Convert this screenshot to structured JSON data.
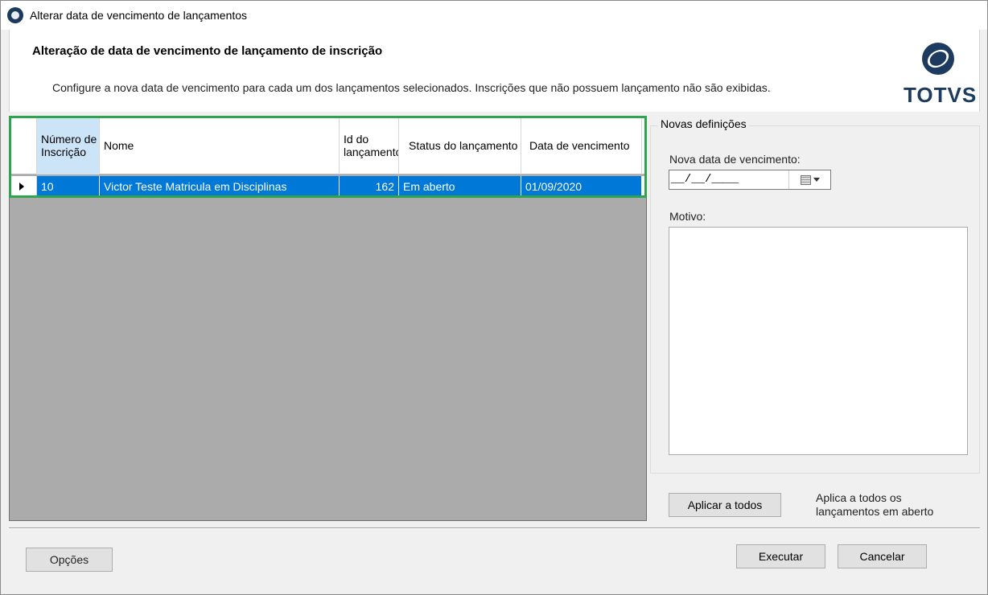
{
  "window": {
    "title": "Alterar data de vencimento de lançamentos",
    "icon": "app-icon"
  },
  "header": {
    "title": "Alteração de data de vencimento de lançamento de inscrição",
    "description": "Configure a nova data de vencimento para cada um dos lançamentos selecionados. Inscrições que não possuem lançamento não são exibidas.",
    "logo_text": "TOTVS"
  },
  "grid": {
    "columns": [
      {
        "label": "Número de Inscrição",
        "selected": true
      },
      {
        "label": "Nome",
        "selected": false
      },
      {
        "label": "Id do lançamento",
        "selected": false
      },
      {
        "label": "Status do lançamento",
        "selected": false
      },
      {
        "label": "Data de vencimento",
        "selected": false
      }
    ],
    "rows": [
      {
        "numero": "10",
        "nome": "Victor Teste Matricula em Disciplinas",
        "id": "162",
        "status": "Em aberto",
        "data": "01/09/2020",
        "selected": true
      }
    ]
  },
  "panel": {
    "legend": "Novas definições",
    "date_label": "Nova data de vencimento:",
    "date_value": "__/__/____",
    "reason_label": "Motivo:",
    "reason_value": "",
    "apply_all_label": "Aplicar a todos",
    "apply_hint": "Aplica a todos os lançamentos em aberto"
  },
  "footer": {
    "options_label": "Opções",
    "execute_label": "Executar",
    "cancel_label": "Cancelar"
  },
  "colors": {
    "selection": "#0078d7",
    "highlight_box": "#2fa44f",
    "brand": "#1d3b5e"
  }
}
